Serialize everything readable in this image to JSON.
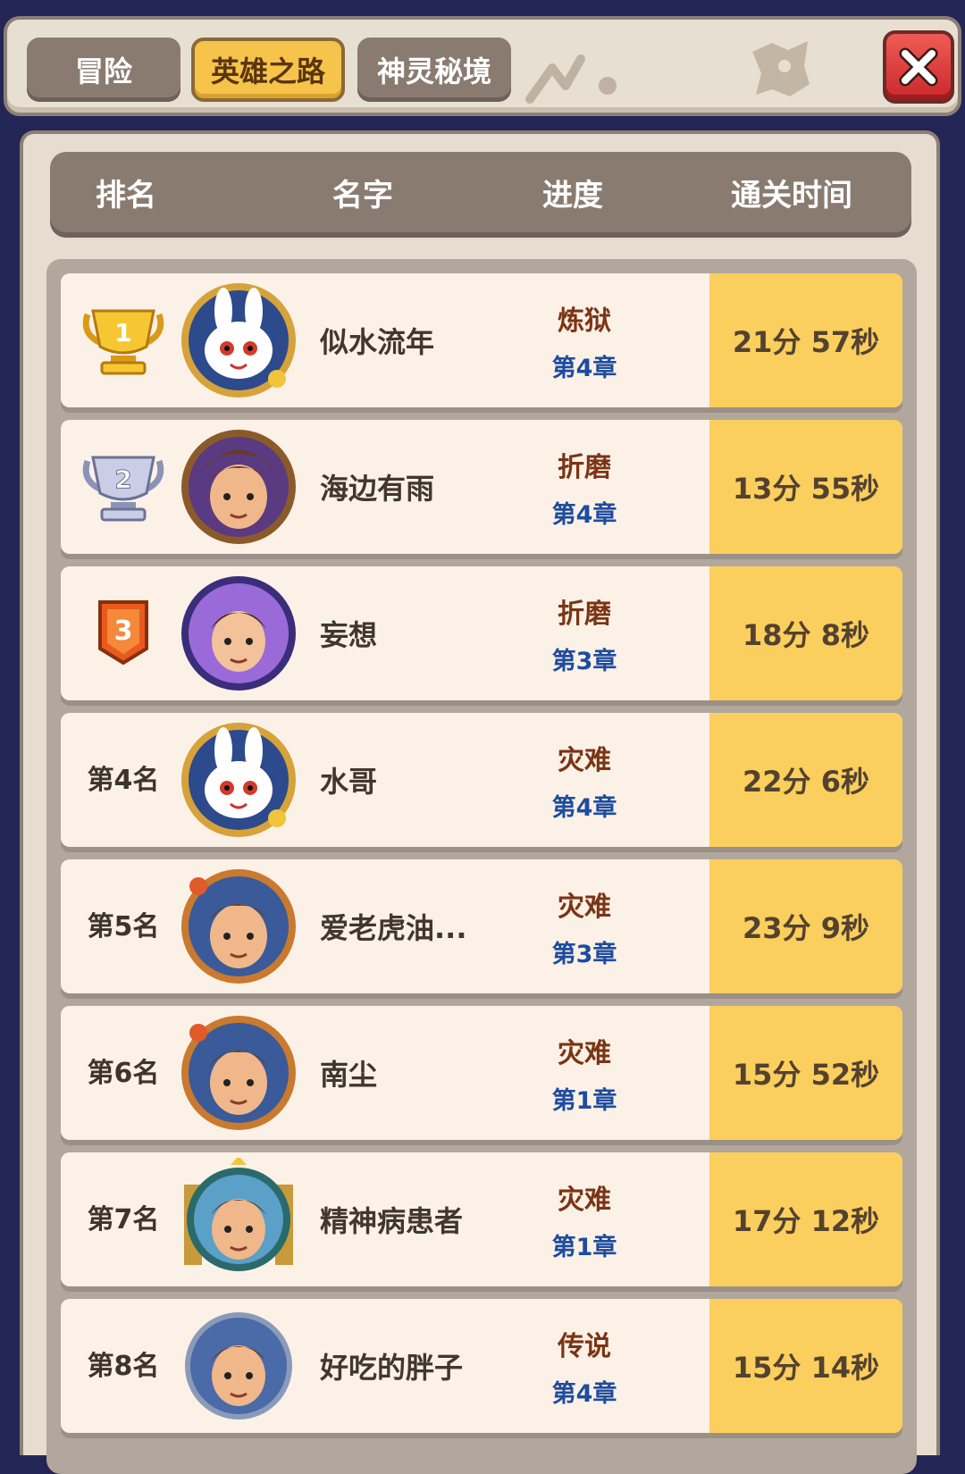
{
  "tabs": [
    {
      "label": "冒险",
      "active": false
    },
    {
      "label": "英雄之路",
      "active": true
    },
    {
      "label": "神灵秘境",
      "active": false
    }
  ],
  "header": {
    "rank": "排名",
    "name": "名字",
    "progress": "进度",
    "time": "通关时间"
  },
  "rows": [
    {
      "rank": "1",
      "name": "似水流年",
      "difficulty": "炼狱",
      "chapter": "第4章",
      "time": "21分 57秒",
      "avatar": "rabbit-avatar",
      "medal": "gold-trophy"
    },
    {
      "rank": "2",
      "name": "海边有雨",
      "difficulty": "折磨",
      "chapter": "第4章",
      "time": "13分 55秒",
      "avatar": "warrior-avatar",
      "medal": "silver-trophy"
    },
    {
      "rank": "3",
      "name": "妄想",
      "difficulty": "折磨",
      "chapter": "第3章",
      "time": "18分 8秒",
      "avatar": "prince-avatar",
      "medal": "bronze-badge"
    },
    {
      "rank": "第4名",
      "name": "水哥",
      "difficulty": "灾难",
      "chapter": "第4章",
      "time": "22分 6秒",
      "avatar": "rabbit-avatar"
    },
    {
      "rank": "第5名",
      "name": "爱老虎油...",
      "difficulty": "灾难",
      "chapter": "第3章",
      "time": "23分 9秒",
      "avatar": "warrior-avatar"
    },
    {
      "rank": "第6名",
      "name": "南尘",
      "difficulty": "灾难",
      "chapter": "第1章",
      "time": "15分 52秒",
      "avatar": "warrior-avatar"
    },
    {
      "rank": "第7名",
      "name": "精神病患者",
      "difficulty": "灾难",
      "chapter": "第1章",
      "time": "17分 12秒",
      "avatar": "warrior-avatar"
    },
    {
      "rank": "第8名",
      "name": "好吃的胖子",
      "difficulty": "传说",
      "chapter": "第4章",
      "time": "15分 14秒",
      "avatar": "warrior-avatar"
    }
  ],
  "colors": {
    "background": "#232654",
    "accent": "#f6c44b",
    "time_cell": "#fbcf5d",
    "difficulty": "#7a3515",
    "chapter": "#1e4c9e"
  }
}
